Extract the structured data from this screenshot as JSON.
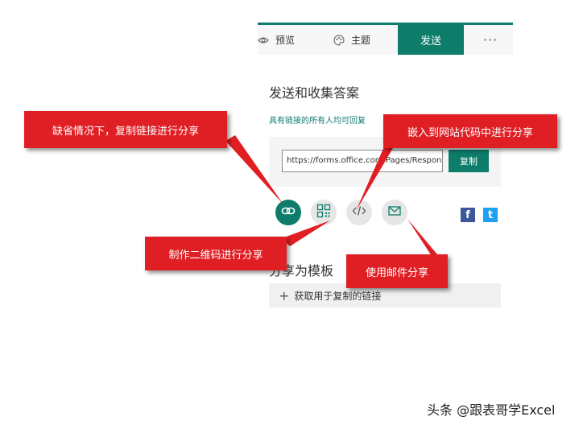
{
  "toolbar": {
    "preview_label": "预览",
    "theme_label": "主题",
    "send_label": "发送",
    "more_label": "···"
  },
  "send_panel": {
    "title": "发送和收集答案",
    "anyone_link_text": "具有链接的所有人均可回复",
    "url_value": "https://forms.office.com/Pages/Respon",
    "copy_label": "复制"
  },
  "share_options": [
    {
      "icon": "link-icon",
      "active": true
    },
    {
      "icon": "qr-code-icon",
      "active": false
    },
    {
      "icon": "embed-code-icon",
      "active": false
    },
    {
      "icon": "email-icon",
      "active": false
    }
  ],
  "social": [
    {
      "icon": "facebook-icon",
      "color": "#3b5998",
      "glyph": "f"
    },
    {
      "icon": "twitter-icon",
      "color": "#1da1f2",
      "glyph": "t"
    }
  ],
  "template": {
    "title": "分享为模板",
    "get_link_label": "获取用于复制的链接"
  },
  "callouts": {
    "copy_link": "缺省情况下，复制链接进行分享",
    "embed": "嵌入到网站代码中进行分享",
    "qr": "制作二维码进行分享",
    "email": "使用邮件分享"
  },
  "watermark": "头条 @跟表哥学Excel",
  "colors": {
    "accent": "#0e7c6b",
    "callout_red": "#e01f25"
  }
}
